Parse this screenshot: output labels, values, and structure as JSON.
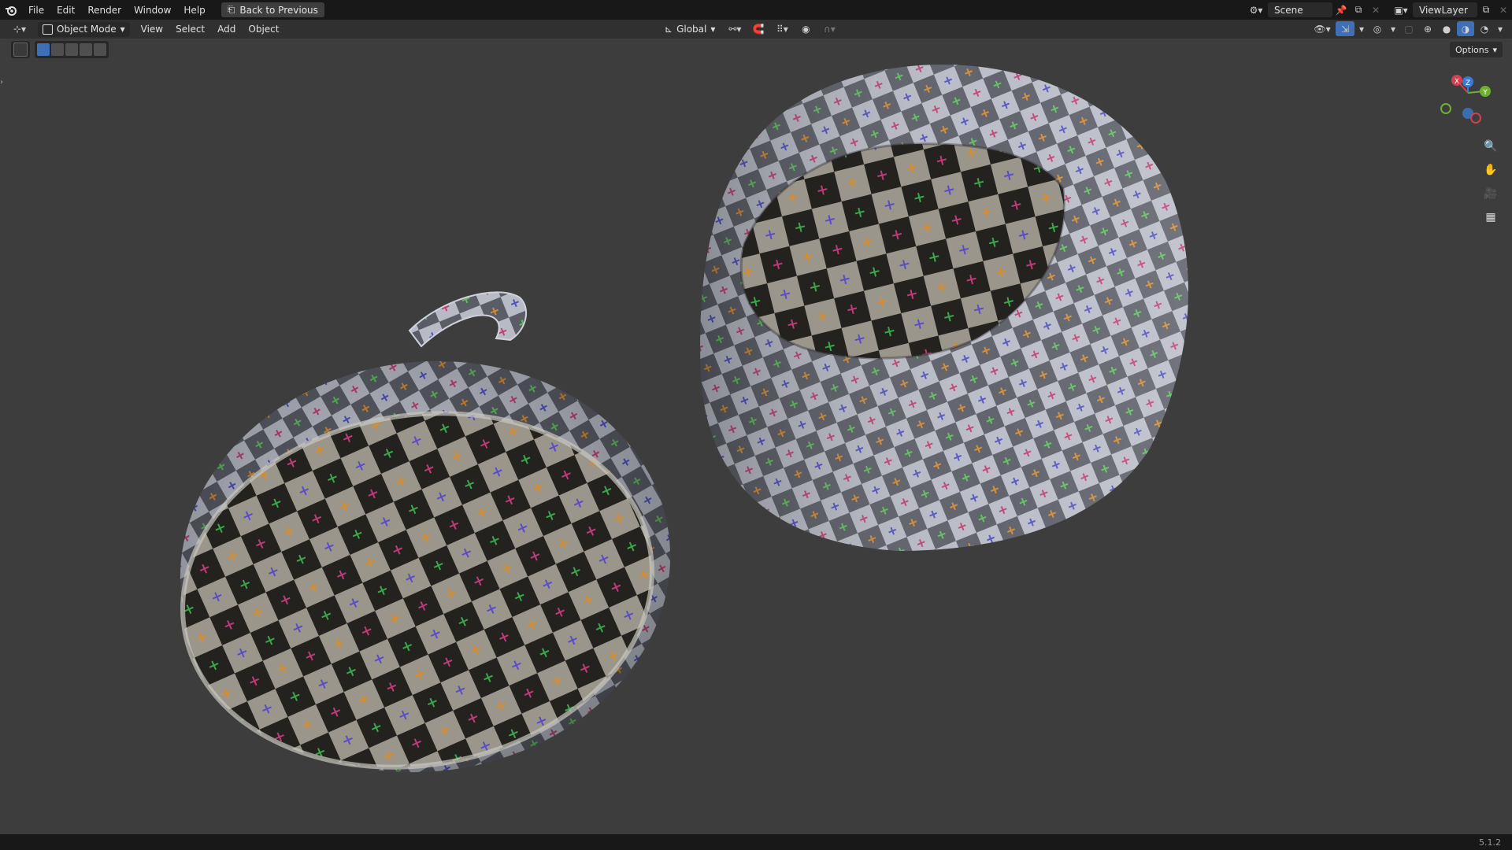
{
  "topbar": {
    "menus": [
      "File",
      "Edit",
      "Render",
      "Window",
      "Help"
    ],
    "back_label": "Back to Previous",
    "scene_name": "Scene",
    "view_layer": "ViewLayer"
  },
  "header": {
    "mode_label": "Object Mode",
    "menus": [
      "View",
      "Select",
      "Add",
      "Object"
    ],
    "orientation_label": "Global"
  },
  "viewport": {
    "options_label": "Options",
    "gizmo_axes": [
      "X",
      "Y",
      "Z"
    ]
  },
  "status": {
    "version": "5.1.2"
  }
}
